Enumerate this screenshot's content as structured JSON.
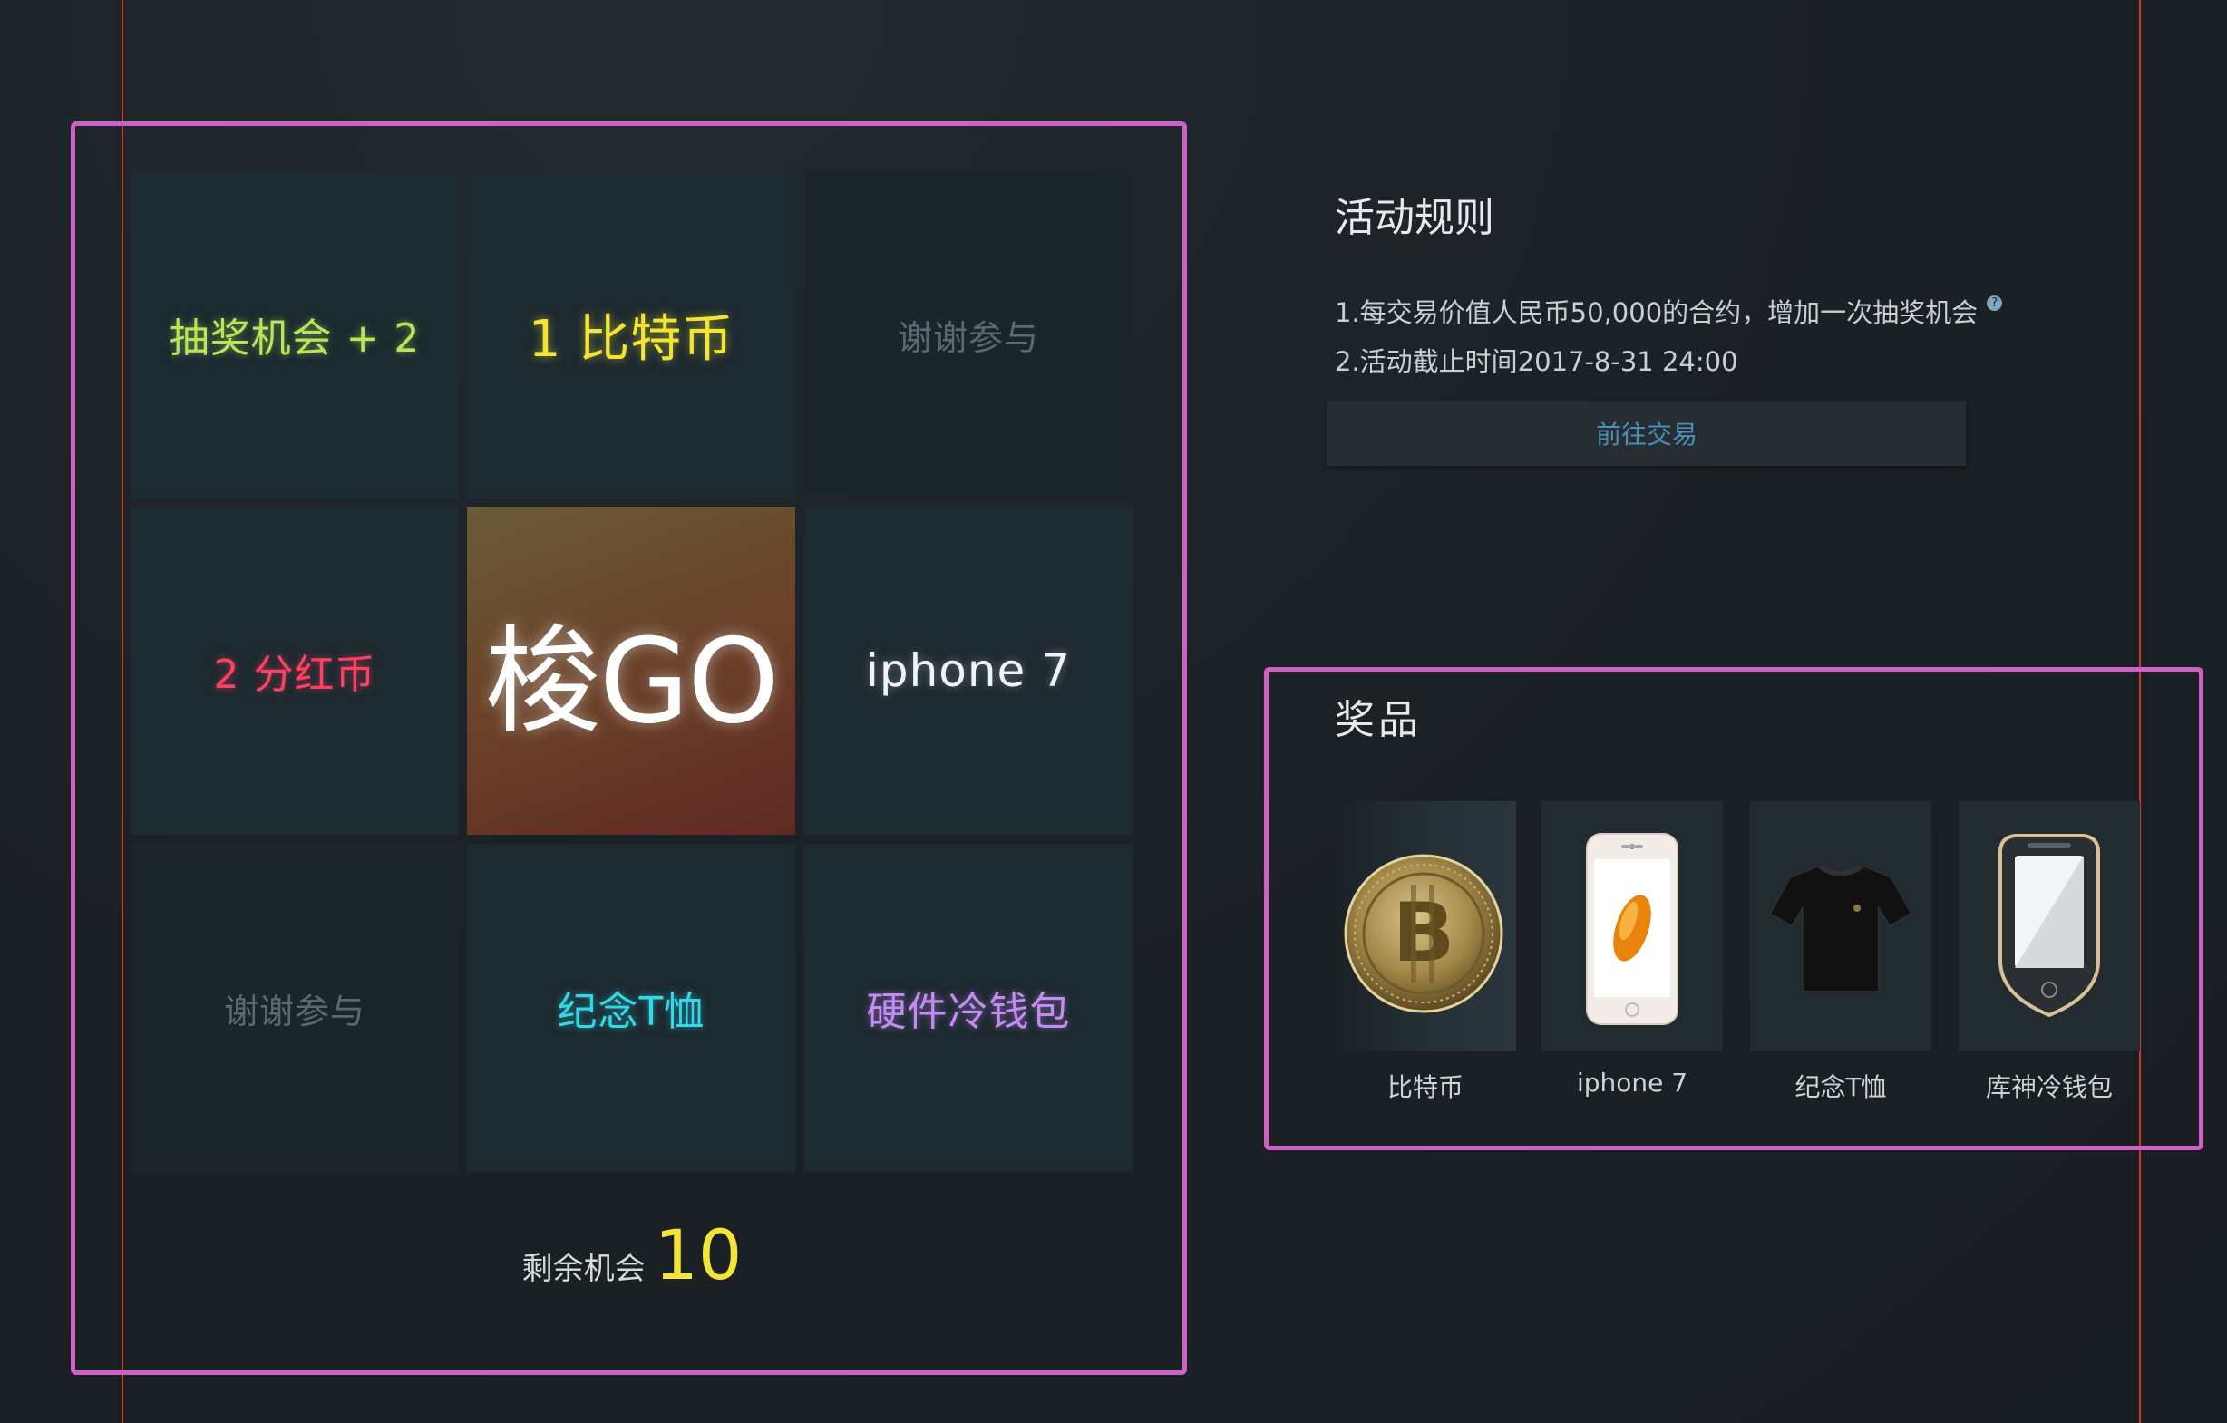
{
  "lottery": {
    "cells": [
      {
        "label": "抽奖机会 + 2"
      },
      {
        "label": "1 比特币"
      },
      {
        "label": "谢谢参与"
      },
      {
        "label": "2 分红币"
      },
      {
        "label": "梭GO"
      },
      {
        "label": "iphone 7"
      },
      {
        "label": "谢谢参与"
      },
      {
        "label": "纪念T恤"
      },
      {
        "label": "硬件冷钱包"
      }
    ],
    "remaining_label": "剩余机会",
    "remaining_count": "10"
  },
  "rules": {
    "title": "活动规则",
    "items": [
      "1.每交易价值人民币50,000的合约，增加一次抽奖机会",
      "2.活动截止时间2017-8-31 24:00"
    ],
    "help_icon": "question-circle-icon",
    "trade_button": "前往交易"
  },
  "prizes": {
    "title": "奖品",
    "items": [
      {
        "name": "比特币",
        "icon": "bitcoin-coin-image"
      },
      {
        "name": "iphone 7",
        "icon": "iphone-image"
      },
      {
        "name": "纪念T恤",
        "icon": "tshirt-image"
      },
      {
        "name": "库神冷钱包",
        "icon": "cold-wallet-image"
      }
    ]
  },
  "colors": {
    "background": "#1b2024",
    "cell": "#1d2a30",
    "accent_yellow": "#f4e534",
    "accent_blue": "#4a8fb4",
    "highlight_frame": "#d060c8",
    "guide_line": "#c9392f"
  }
}
